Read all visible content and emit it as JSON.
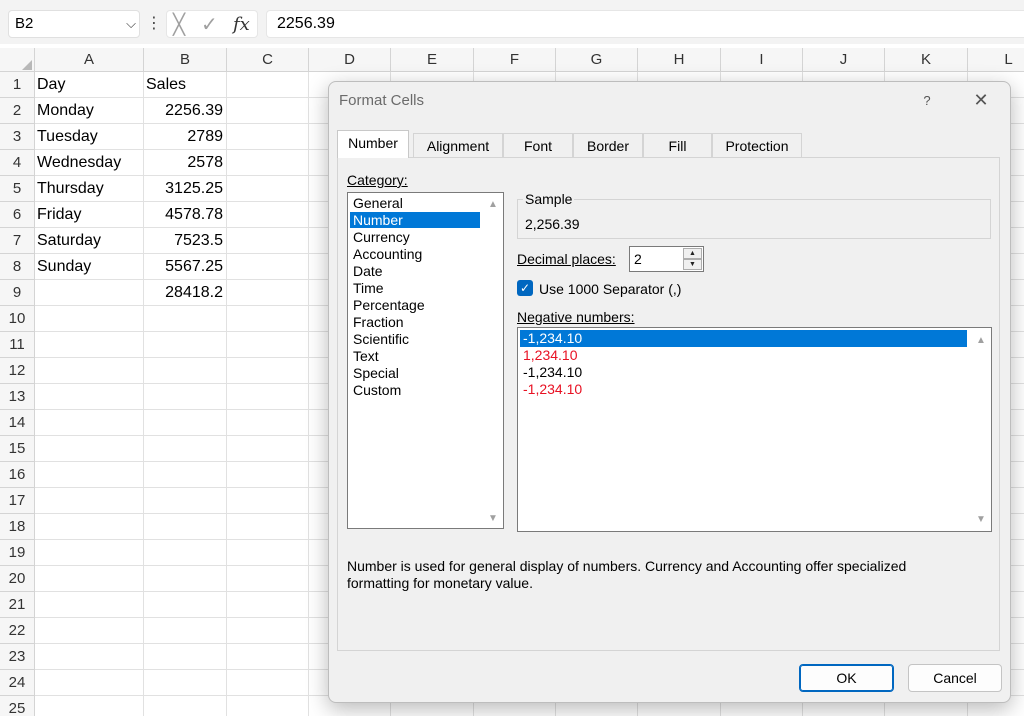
{
  "formula_bar": {
    "name_box": "B2",
    "name_box_chevron": "⌵",
    "formula": "2256.39",
    "more_icon": "⋮",
    "cancel_icon": "╳",
    "enter_icon": "✓",
    "function_icon": "fx"
  },
  "columns": [
    "A",
    "B",
    "C",
    "D",
    "E",
    "F",
    "G",
    "H",
    "I",
    "J",
    "K",
    "L"
  ],
  "rows": [
    "1",
    "2",
    "3",
    "4",
    "5",
    "6",
    "7",
    "8",
    "9",
    "10",
    "11",
    "12",
    "13",
    "14",
    "15",
    "16",
    "17",
    "18",
    "19",
    "20",
    "21",
    "22",
    "23",
    "24",
    "25"
  ],
  "cells": {
    "A1": "Day",
    "B1": "Sales",
    "A2": "Monday",
    "B2": "2256.39",
    "A3": "Tuesday",
    "B3": "2789",
    "A4": "Wednesday",
    "B4": "2578",
    "A5": "Thursday",
    "B5": "3125.25",
    "A6": "Friday",
    "B6": "4578.78",
    "A7": "Saturday",
    "B7": "7523.5",
    "A8": "Sunday",
    "B8": "5567.25",
    "B9": "28418.2"
  },
  "dialog": {
    "title": "Format Cells",
    "help": "?",
    "close": "✕",
    "tabs": [
      "Number",
      "Alignment",
      "Font",
      "Border",
      "Fill",
      "Protection"
    ],
    "active_tab": "Number",
    "category_label": "Category:",
    "categories": [
      "General",
      "Number",
      "Currency",
      "Accounting",
      "Date",
      "Time",
      "Percentage",
      "Fraction",
      "Scientific",
      "Text",
      "Special",
      "Custom"
    ],
    "selected_category": "Number",
    "sample_label": "Sample",
    "sample_value": "2,256.39",
    "decimal_places_label": "Decimal places:",
    "decimal_places_value": "2",
    "use_separator_label": "Use 1000 Separator (,)",
    "use_separator_checked": true,
    "negative_numbers_label": "Negative numbers:",
    "negative_numbers": [
      {
        "text": "-1,234.10",
        "color": "#000000",
        "selected": true
      },
      {
        "text": "1,234.10",
        "color": "#e81123",
        "selected": false
      },
      {
        "text": "-1,234.10",
        "color": "#000000",
        "selected": false
      },
      {
        "text": "-1,234.10",
        "color": "#e81123",
        "selected": false
      }
    ],
    "description_line1": "Number is used for general display of numbers.  Currency and Accounting offer specialized",
    "description_line2": "formatting for monetary value.",
    "ok_label": "OK",
    "cancel_label": "Cancel"
  },
  "colors": {
    "selection": "#0078d7",
    "negative_red": "#e81123",
    "checkbox_accent": "#0067c0"
  }
}
